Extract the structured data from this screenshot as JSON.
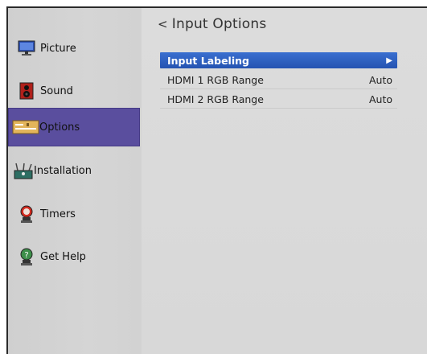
{
  "sidebar": {
    "items": [
      {
        "label": "Picture",
        "icon": "monitor-icon"
      },
      {
        "label": "Sound",
        "icon": "speaker-icon"
      },
      {
        "label": "Options",
        "icon": "options-panel-icon",
        "active": true
      },
      {
        "label": "Installation",
        "icon": "satellite-tools-icon"
      },
      {
        "label": "Timers",
        "icon": "alarm-icon"
      },
      {
        "label": "Get Help",
        "icon": "help-globe-icon"
      }
    ]
  },
  "main": {
    "title": "Input Options",
    "back_glyph": "<",
    "rows": [
      {
        "label": "Input Labeling",
        "value": "",
        "selected": true
      },
      {
        "label": "HDMI 1 RGB Range",
        "value": "Auto"
      },
      {
        "label": "HDMI 2 RGB Range",
        "value": "Auto"
      }
    ]
  },
  "colors": {
    "active_menu": "#5a4e9e",
    "selected_row": "#2a5cc0",
    "background": "#d7d7d7"
  }
}
